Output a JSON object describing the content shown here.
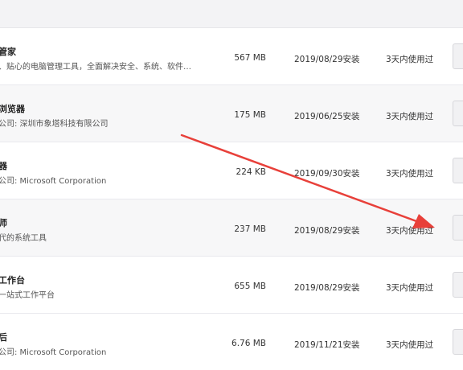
{
  "apps": [
    {
      "name": "管家",
      "desc": "、贴心的电脑管理工具，全面解决安全、系统、软件…",
      "size": "567 MB",
      "installed": "2019/08/29安装",
      "usage": "3天内使用过"
    },
    {
      "name": "浏览器",
      "desc": "公司: 深圳市象塔科技有限公司",
      "size": "175 MB",
      "installed": "2019/06/25安装",
      "usage": "3天内使用过"
    },
    {
      "name": "器",
      "desc": "公司: Microsoft Corporation",
      "size": "224 KB",
      "installed": "2019/09/30安装",
      "usage": "3天内使用过"
    },
    {
      "name": "师",
      "desc": "代的系统工具",
      "size": "237 MB",
      "installed": "2019/08/29安装",
      "usage": "3天内使用过"
    },
    {
      "name": "工作台",
      "desc": "一站式工作平台",
      "size": "655 MB",
      "installed": "2019/08/29安装",
      "usage": "3天内使用过"
    },
    {
      "name": "后",
      "desc": "公司: Microsoft Corporation",
      "size": "6.76 MB",
      "installed": "2019/11/21安装",
      "usage": "3天内使用过"
    }
  ],
  "colors": {
    "annotation_arrow": "#e8403a",
    "row_odd": "#ffffff",
    "row_even": "#f7f7f8"
  }
}
